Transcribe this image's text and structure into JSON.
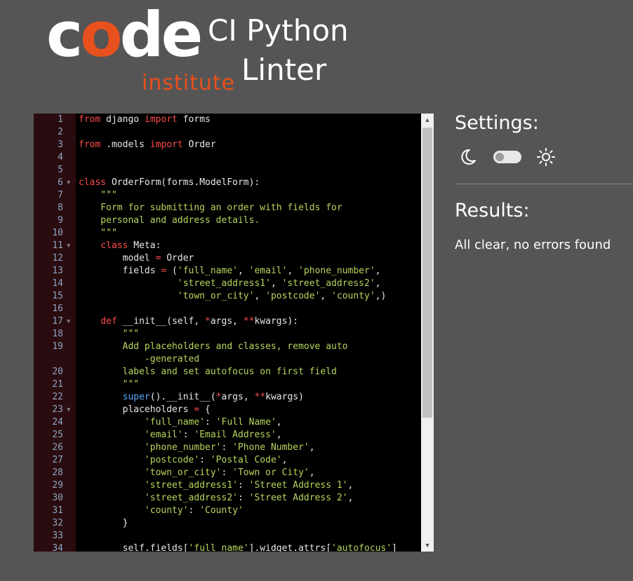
{
  "logo": {
    "word": "code",
    "sub": "institute"
  },
  "app": {
    "title_line1": "CI Python",
    "title_line2": "Linter"
  },
  "settings": {
    "title": "Settings:"
  },
  "results": {
    "title": "Results:",
    "message": "All clear, no errors found"
  },
  "colors": {
    "accent": "#e8501d",
    "background": "#555555",
    "keyword": "#ff4b4b",
    "string": "#b6d65c"
  },
  "code_lines": [
    "from django import forms",
    "",
    "from .models import Order",
    "",
    "",
    "class OrderForm(forms.ModelForm):",
    "    \"\"\"",
    "    Form for submitting an order with fields for",
    "    personal and address details.",
    "    \"\"\"",
    "    class Meta:",
    "        model = Order",
    "        fields = ('full_name', 'email', 'phone_number',",
    "                  'street_address1', 'street_address2',",
    "                  'town_or_city', 'postcode', 'county',)",
    "",
    "    def __init__(self, *args, **kwargs):",
    "        \"\"\"",
    "        Add placeholders and classes, remove auto\n            -generated",
    "        labels and set autofocus on first field",
    "        \"\"\"",
    "        super().__init__(*args, **kwargs)",
    "        placeholders = {",
    "            'full_name': 'Full Name',",
    "            'email': 'Email Address',",
    "            'phone_number': 'Phone Number',",
    "            'postcode': 'Postal Code',",
    "            'town_or_city': 'Town or City',",
    "            'street_address1': 'Street Address 1',",
    "            'street_address2': 'Street Address 2',",
    "            'county': 'County'",
    "        }",
    "",
    "        self.fields['full_name'].widget.attrs['autofocus']"
  ],
  "fold_lines": [
    6,
    11,
    17,
    23
  ]
}
